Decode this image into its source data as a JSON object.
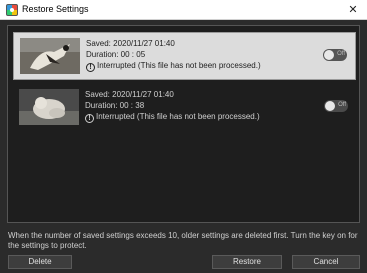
{
  "window": {
    "title": "Restore Settings",
    "app_icon": "app-logo-icon",
    "close_label": "✕"
  },
  "items": [
    {
      "saved": "Saved: 2020/11/27 01:40",
      "duration": "Duration: 00 : 05",
      "status": "Interrupted (This file has not been processed.)",
      "status_icon": "info-icon",
      "toggle_label": "Off",
      "toggle_on": false,
      "selected": true
    },
    {
      "saved": "Saved: 2020/11/27 01:40",
      "duration": "Duration: 00 : 38",
      "status": "Interrupted (This file has not been processed.)",
      "status_icon": "info-icon",
      "toggle_label": "Off",
      "toggle_on": false,
      "selected": false
    }
  ],
  "note": "When the number of saved settings exceeds 10, older settings are deleted first. Turn the key on for the settings to protect.",
  "buttons": {
    "delete": "Delete",
    "restore": "Restore",
    "cancel": "Cancel"
  }
}
